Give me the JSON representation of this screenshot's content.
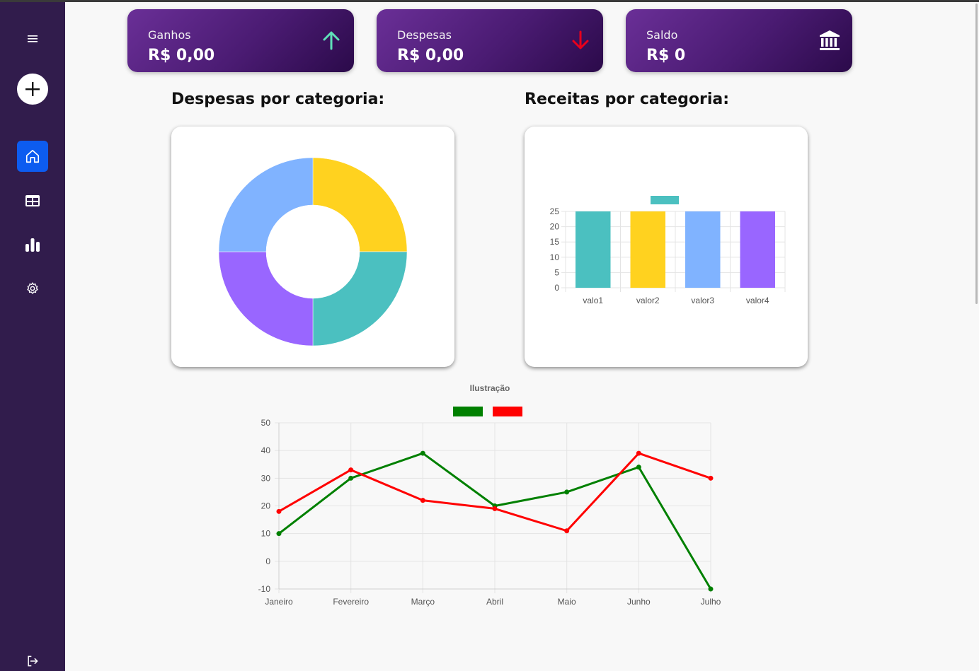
{
  "sidebar": {
    "menu_icon": "hamburger-menu-icon",
    "add_icon": "plus-icon",
    "items": [
      {
        "icon": "home-icon",
        "active": true
      },
      {
        "icon": "table-icon",
        "active": false
      },
      {
        "icon": "bar-chart-icon",
        "active": false
      },
      {
        "icon": "gear-icon",
        "active": false
      }
    ],
    "logout_icon": "logout-icon"
  },
  "cards": [
    {
      "title": "Ganhos",
      "value": "R$ 0,00",
      "icon": "arrow-up-icon",
      "icon_color": "#5fe0b8"
    },
    {
      "title": "Despesas",
      "value": "R$ 0,00",
      "icon": "arrow-down-icon",
      "icon_color": "#e8001c"
    },
    {
      "title": "Saldo",
      "value": "R$ 0",
      "icon": "bank-icon",
      "icon_color": "#ffffff"
    }
  ],
  "sections": {
    "expenses_title": "Despesas por categoria:",
    "income_title": "Receitas por categoria:"
  },
  "colors": {
    "sidebar_bg": "#311c4c",
    "active_item": "#0d5cf0",
    "card_gradient_start": "#6a2f97",
    "card_gradient_end": "#2b0a4a"
  },
  "chart_data": [
    {
      "type": "pie",
      "subtype": "doughnut",
      "values": [
        25,
        25,
        25,
        25
      ],
      "colors": [
        "#ffd21f",
        "#4bc0c0",
        "#9966ff",
        "#80b3ff"
      ]
    },
    {
      "type": "bar",
      "categories": [
        "valo1",
        "valor2",
        "valor3",
        "valor4"
      ],
      "values": [
        25,
        25,
        25,
        25
      ],
      "colors": [
        "#4bc0c0",
        "#ffd21f",
        "#80b3ff",
        "#9966ff"
      ],
      "legend_color": "#4bc0c0",
      "legend_placement": "top",
      "ylim": [
        0,
        25
      ],
      "yticks": [
        0,
        5,
        10,
        15,
        20,
        25
      ],
      "grid": true
    },
    {
      "type": "line",
      "title": "Ilustração",
      "categories": [
        "Janeiro",
        "Fevereiro",
        "Março",
        "Abril",
        "Maio",
        "Junho",
        "Julho"
      ],
      "series": [
        {
          "color": "#008000",
          "values": [
            10,
            30,
            39,
            20,
            25,
            34,
            -10
          ]
        },
        {
          "color": "#ff0000",
          "values": [
            18,
            33,
            22,
            19,
            11,
            39,
            30
          ]
        }
      ],
      "ylim": [
        -10,
        50
      ],
      "yticks": [
        -10,
        0,
        10,
        20,
        30,
        40,
        50
      ],
      "legend_placement": "top",
      "grid": true
    }
  ]
}
